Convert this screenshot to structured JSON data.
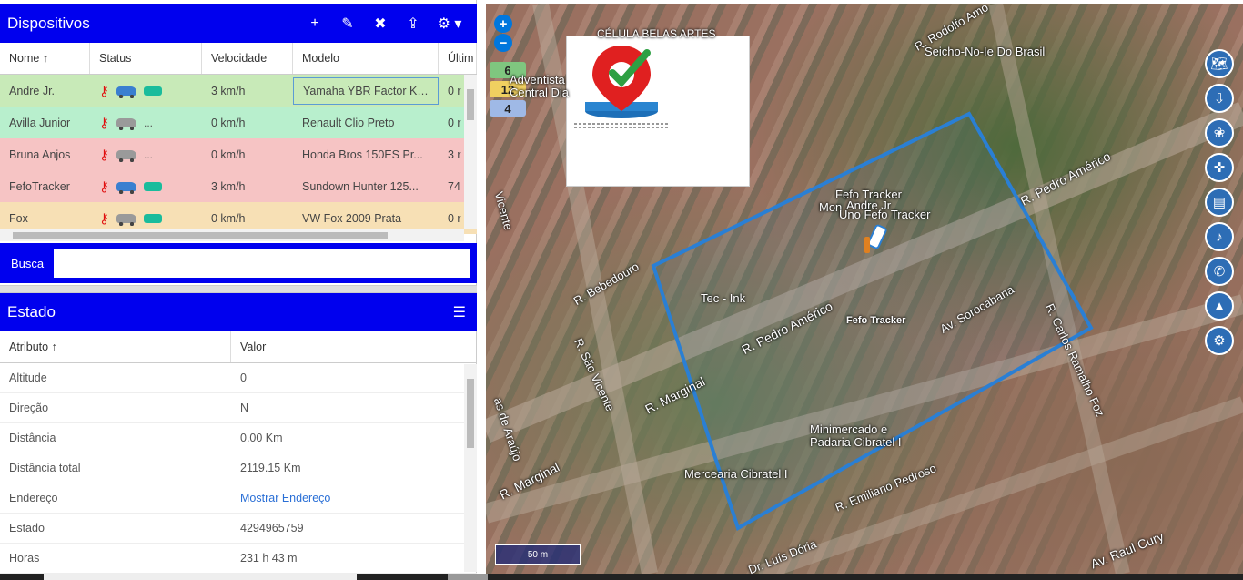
{
  "devices_panel": {
    "title": "Dispositivos",
    "toolbar": {
      "add": "+",
      "edit": "✎",
      "remove": "✖",
      "upload": "⇪",
      "settings": "⚙ ▾"
    },
    "columns": [
      "Nome ↑",
      "Status",
      "Velocidade",
      "Modelo",
      "Últim"
    ],
    "rows": [
      {
        "nome": "Andre Jr.",
        "velocidade": "3 km/h",
        "modelo": "Yamaha YBR Factor K ...",
        "ultima": "0 r",
        "bg": "#c8eab8",
        "car_color": "#3a7fd0",
        "extra": "pill"
      },
      {
        "nome": "Avilla Junior",
        "velocidade": "0 km/h",
        "modelo": "Renault Clio Preto",
        "ultima": "0 r",
        "bg": "#b8efcd",
        "car_color": "#9a9a9a",
        "extra": "..."
      },
      {
        "nome": "Bruna Anjos",
        "velocidade": "0 km/h",
        "modelo": "Honda Bros 150ES Pr...",
        "ultima": "3 r",
        "bg": "#f6c4c4",
        "car_color": "#9a9a9a",
        "extra": "..."
      },
      {
        "nome": "FefoTracker",
        "velocidade": "3 km/h",
        "modelo": "Sundown Hunter 125...",
        "ultima": "74",
        "bg": "#f6c4c4",
        "car_color": "#3a7fd0",
        "extra": "pill"
      },
      {
        "nome": "Fox",
        "velocidade": "0 km/h",
        "modelo": "VW Fox 2009 Prata",
        "ultima": "0 r",
        "bg": "#f7e0b5",
        "car_color": "#9a9a9a",
        "extra": "pill"
      }
    ]
  },
  "search": {
    "label": "Busca",
    "value": ""
  },
  "state_panel": {
    "title": "Estado",
    "columns": [
      "Atributo ↑",
      "Valor"
    ],
    "rows": [
      {
        "attr": "Altitude",
        "value": "0"
      },
      {
        "attr": "Direção",
        "value": "N"
      },
      {
        "attr": "Distância",
        "value": "0.00 Km"
      },
      {
        "attr": "Distância total",
        "value": "2119.15 Km"
      },
      {
        "attr": "Endereço",
        "value": "Mostrar Endereço",
        "link": true
      },
      {
        "attr": "Estado",
        "value": "4294965759"
      },
      {
        "attr": "Horas",
        "value": "231 h 43 m"
      }
    ]
  },
  "map": {
    "zoom_in": "+",
    "zoom_out": "−",
    "clusters": [
      {
        "count": "6",
        "color": "#7fc67f"
      },
      {
        "count": "12",
        "color": "#f0d060"
      },
      {
        "count": "4",
        "color": "#9fb9e6"
      }
    ],
    "logo_text": "FefoTracker",
    "scale": "50 m",
    "labels": [
      "CÉLULA BELAS ARTES",
      "R. Rodolfo Amo",
      "Seicho-No-Ie Do Brasil",
      "Adventista",
      "Central Dia",
      "Fefo Tracker",
      "Andre Jr",
      "Mon",
      "Uno Fefo Tracker",
      "R. Pedro Américo",
      "R. Bebedouro",
      "Tec - Ink",
      "R. Pedro Américo",
      "Fefo Tracker",
      "Av. Sorocabana",
      "R. Carlos Ramalho Foz",
      "R. São Vicente",
      "R. Marginal",
      "R. Marginal",
      "Minimercado e",
      "Padaria Cibratel I",
      "Mercearia Cibratel I",
      "R. Emiliano Pedroso",
      "Dr. Luís Dória",
      "Av. Raul Cury",
      "Vicente",
      "as de Araújo"
    ],
    "right_buttons": [
      "map-icon",
      "upload-icon",
      "paw-icon",
      "crosshair-icon",
      "document-icon",
      "bell-icon",
      "whatsapp-icon",
      "road-icon",
      "gear-icon"
    ],
    "fence_color": "#2a7fd4"
  }
}
